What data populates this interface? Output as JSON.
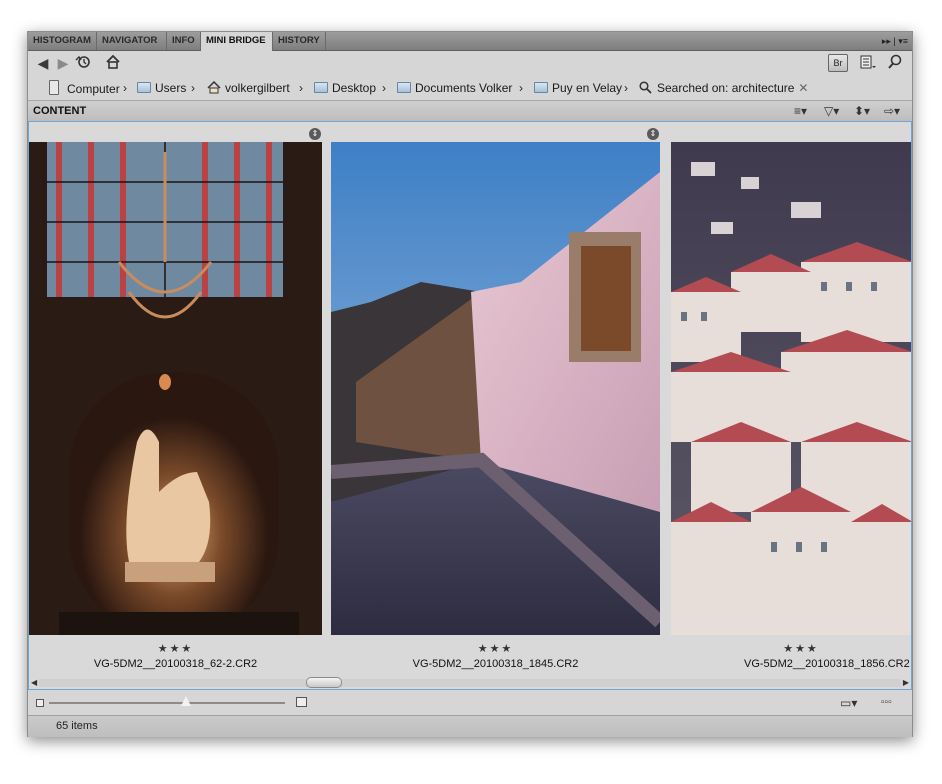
{
  "tabs": [
    {
      "label": "HISTOGRAM",
      "active": false
    },
    {
      "label": "NAVIGATOR",
      "active": false
    },
    {
      "label": "INFO",
      "active": false
    },
    {
      "label": "MINI BRIDGE",
      "active": true
    },
    {
      "label": "HISTORY",
      "active": false
    }
  ],
  "tabbar_right": "▸▸ | ▾≡",
  "toolbar": {
    "back_icon": "back-arrow-icon",
    "forward_icon": "forward-arrow-icon",
    "recent_icon": "recent-folders-icon",
    "home_icon": "home-icon",
    "bridge_button": "Br",
    "panel_view_icon": "panel-view-icon",
    "search_icon": "search-icon"
  },
  "breadcrumb": [
    {
      "label": "Computer",
      "icon": "computer-icon"
    },
    {
      "label": "Users",
      "icon": "folder-icon"
    },
    {
      "label": "volkergilbert",
      "icon": "home-icon"
    },
    {
      "label": "Desktop",
      "icon": "folder-icon"
    },
    {
      "label": "Documents Volker",
      "icon": "folder-icon"
    },
    {
      "label": "Puy en Velay",
      "icon": "folder-icon"
    },
    {
      "label": "Searched on: architecture",
      "icon": "search-icon"
    }
  ],
  "content": {
    "title": "CONTENT",
    "header_icons": [
      "sort-icon",
      "filter-icon",
      "view-order-icon",
      "tools-icon"
    ]
  },
  "thumbnails": [
    {
      "filename": "VG-5DM2__20100318_62-2.CR2",
      "stars": "★★★",
      "rating": 3,
      "subject": "cathedral stained glass and statue"
    },
    {
      "filename": "VG-5DM2__20100318_1845.CR2",
      "stars": "★★★",
      "rating": 3,
      "subject": "street with stone wall at dusk"
    },
    {
      "filename": "VG-5DM2__20100318_1856.CR2",
      "stars": "★★★",
      "rating": 3,
      "subject": "hillside town rooftops"
    }
  ],
  "status": {
    "item_count": "65 items"
  },
  "colors": {
    "panel_bg": "#d6d6d6",
    "selection_border": "#6fa6d6",
    "tab_bar": "#8d8d8d"
  }
}
